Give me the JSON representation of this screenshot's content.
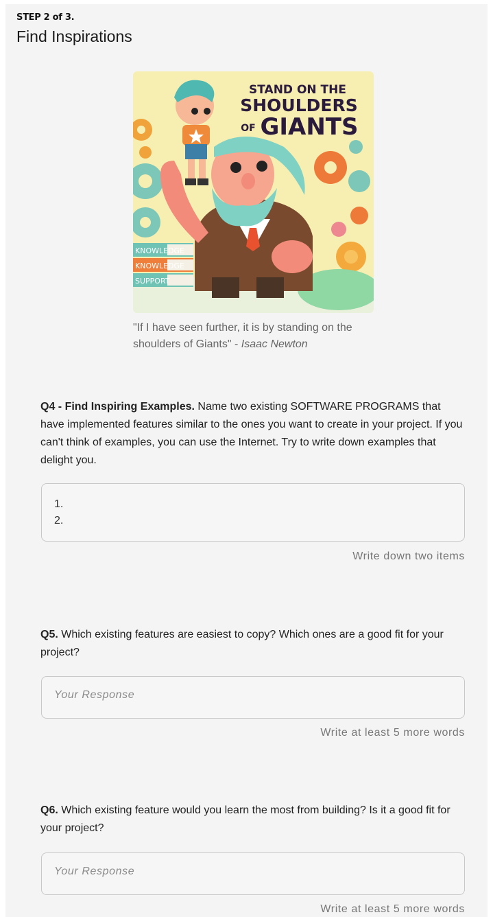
{
  "step": {
    "label": "STEP 2 of 3.",
    "title": "Find Inspirations"
  },
  "hero": {
    "heading_line1": "STAND ON THE",
    "heading_line2": "SHOULDERS",
    "heading_of": "OF",
    "heading_line3": "GIANTS",
    "book_labels": [
      "KNOWLEDGE",
      "KNOWLEDGE",
      "SUPPORT"
    ]
  },
  "quote": {
    "text": "\"If I have seen further, it is by standing on the shoulders of Giants\" - ",
    "author": "Isaac Newton"
  },
  "q4": {
    "bold": "Q4 - Find Inspiring Examples.",
    "text": " Name two existing SOFTWARE PROGRAMS that have implemented features similar to the ones you want to create in your project. If you can't think of examples, you can use the Internet. Try to write down examples that delight you.",
    "lines": [
      "1.",
      "2."
    ],
    "helper": "Write down two items"
  },
  "q5": {
    "bold": "Q5.",
    "text": " Which existing features are easiest to copy? Which ones are a good fit for your project?",
    "placeholder": "Your Response",
    "helper": "Write at least 5 more words"
  },
  "q6": {
    "bold": "Q6.",
    "text": " Which existing feature would you learn the most from building? Is it a good fit for your project?",
    "placeholder": "Your Response",
    "helper": "Write at least 5 more words"
  }
}
